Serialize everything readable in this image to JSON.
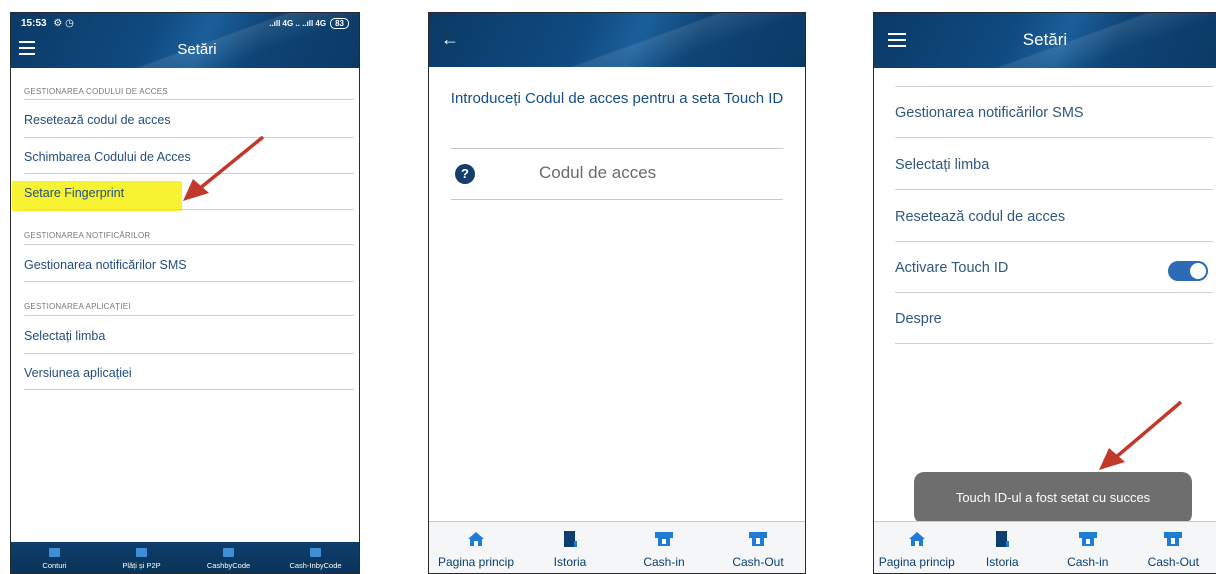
{
  "screen1": {
    "status": {
      "time": "15:53",
      "left_icons": "⚙ ◷",
      "network": "..ıll 4G .. ..ıll 4G",
      "battery": "83"
    },
    "title": "Setări",
    "sections": [
      {
        "heading": "GESTIONAREA CODULUI DE ACCES",
        "items": [
          "Resetează codul de acces",
          "Schimbarea Codului de Acces",
          "Setare Fingerprint"
        ]
      },
      {
        "heading": "GESTIONAREA NOTIFICĂRILOR",
        "items": [
          "Gestionarea notificărilor SMS"
        ]
      },
      {
        "heading": "GESTIONAREA APLICAȚIEI",
        "items": [
          "Selectați limba",
          "Versiunea aplicației"
        ]
      }
    ],
    "highlighted_item": "Setare Fingerprint",
    "highlight_color": "#f7f232",
    "bottom_nav": [
      "Conturi",
      "Plăți și P2P",
      "CashbyCode",
      "Cash-InbyCode"
    ]
  },
  "screen2": {
    "prompt": "Introduceți Codul de acces pentru a seta Touch ID",
    "code_placeholder": "Codul de acces",
    "bottom_nav": [
      "Pagina princip",
      "Istoria",
      "Cash-in",
      "Cash-Out"
    ]
  },
  "screen3": {
    "title": "Setări",
    "items": [
      "Gestionarea notificărilor SMS",
      "Selectați limba",
      "Resetează codul de acces",
      "Activare Touch ID",
      "Despre"
    ],
    "touch_id_enabled": true,
    "toast": "Touch ID-ul a fost setat cu succes",
    "bottom_nav": [
      "Pagina princip",
      "Istoria",
      "Cash-in",
      "Cash-Out"
    ]
  },
  "colors": {
    "header": "#0f4a80",
    "accent": "#2d6bb6",
    "annotation_arrow": "#c0392b"
  }
}
